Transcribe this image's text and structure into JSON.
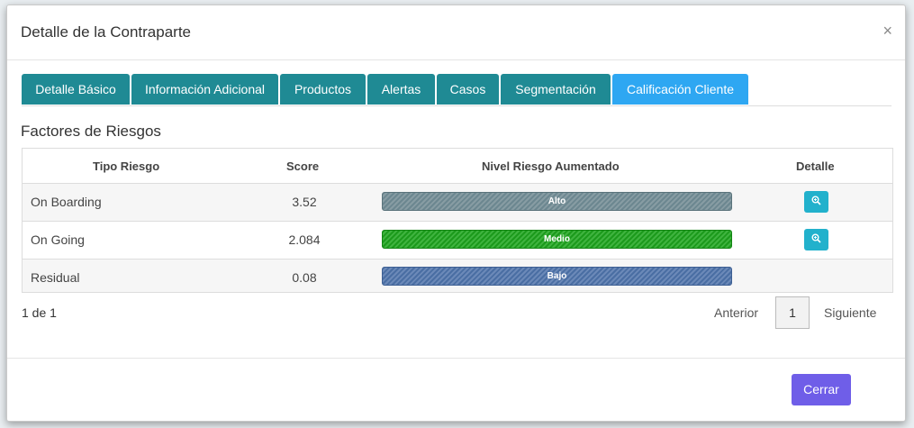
{
  "modal": {
    "title": "Detalle de la Contraparte",
    "close_symbol": "×"
  },
  "tabs": [
    {
      "label": "Detalle Básico"
    },
    {
      "label": "Información Adicional"
    },
    {
      "label": "Productos"
    },
    {
      "label": "Alertas"
    },
    {
      "label": "Casos"
    },
    {
      "label": "Segmentación"
    },
    {
      "label": "Calificación Cliente",
      "active": true
    }
  ],
  "section": {
    "title": "Factores de Riesgos"
  },
  "table": {
    "headers": [
      "Tipo Riesgo",
      "Score",
      "Nivel Riesgo Aumentado",
      "Detalle"
    ],
    "rows": [
      {
        "tipo": "On Boarding",
        "score": "3.52",
        "nivel": "Alto",
        "has_detail": true
      },
      {
        "tipo": "On Going",
        "score": "2.084",
        "nivel": "Medio",
        "has_detail": true
      },
      {
        "tipo": "Residual",
        "score": "0.08",
        "nivel": "Bajo",
        "has_detail": false
      }
    ]
  },
  "pagination": {
    "info": "1 de 1",
    "prev": "Anterior",
    "page": "1",
    "next": "Siguiente"
  },
  "footer": {
    "close_label": "Cerrar"
  },
  "colors": {
    "tab": "#1f8a94",
    "tab_active": "#2ea7f2",
    "alto": "#6c8790",
    "medio": "#1c9a1c",
    "bajo": "#4a6ea3",
    "detail_button": "#22b1cc",
    "close_button": "#6f5ee8"
  },
  "icons": {
    "detail": "zoom-in-icon",
    "close": "close-icon"
  }
}
